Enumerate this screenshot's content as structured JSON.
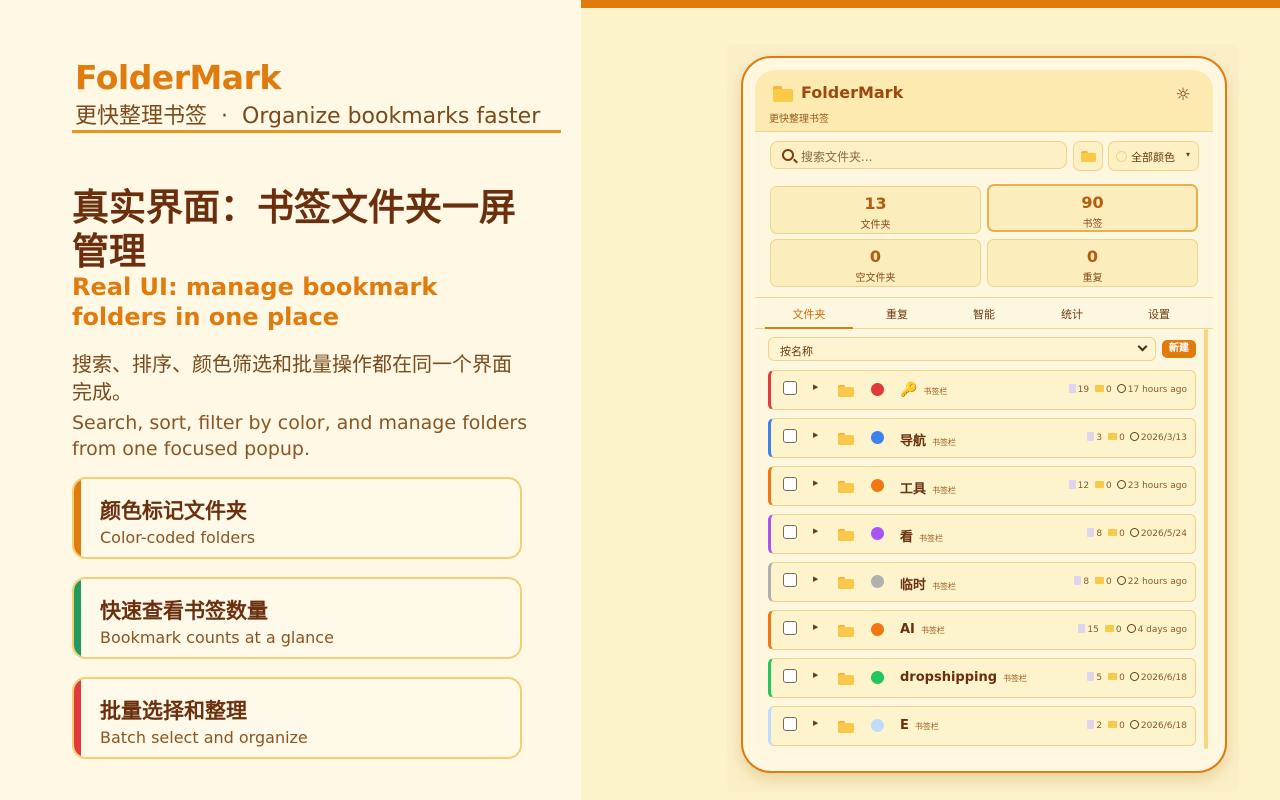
{
  "promo": {
    "brand": "FolderMark",
    "tagline_cn": "更快整理书签",
    "tagline_sep": "·",
    "tagline_en": "Organize bookmarks faster",
    "headline_cn": "真实界面：书签文件夹一屏管理",
    "headline_en": "Real UI: manage bookmark folders in one place",
    "desc_cn": "搜索、排序、颜色筛选和批量操作都在同一个界面完成。",
    "desc_en": "Search, sort, filter by color, and manage folders from one focused popup.",
    "features": [
      {
        "title": "颜色标记文件夹",
        "subtitle": "Color-coded folders",
        "accent": "#e07b0d"
      },
      {
        "title": "快速查看书签数量",
        "subtitle": "Bookmark counts at a glance",
        "accent": "#229a5e"
      },
      {
        "title": "批量选择和整理",
        "subtitle": "Batch select and organize",
        "accent": "#e03a3a"
      }
    ]
  },
  "app": {
    "title": "FolderMark",
    "subtitle": "更快整理书签",
    "search_placeholder": "搜索文件夹...",
    "color_filter": "全部颜色",
    "stats": [
      {
        "value": "13",
        "label": "文件夹"
      },
      {
        "value": "90",
        "label": "书签"
      },
      {
        "value": "0",
        "label": "空文件夹"
      },
      {
        "value": "0",
        "label": "重复"
      }
    ],
    "tabs": [
      "文件夹",
      "重复",
      "智能",
      "统计",
      "设置"
    ],
    "active_tab": "文件夹",
    "sort_label": "按名称",
    "new_button": "新建",
    "folders": [
      {
        "name": "",
        "icon": "key-icon",
        "badge": "书签栏",
        "bookmarks": "19",
        "subfolders": "0",
        "updated": "17 hours ago",
        "color": "#e03a3a"
      },
      {
        "name": "导航",
        "badge": "书签栏",
        "bookmarks": "3",
        "subfolders": "0",
        "updated": "2026/3/13",
        "color": "#3b82f0"
      },
      {
        "name": "工具",
        "badge": "书签栏",
        "bookmarks": "12",
        "subfolders": "0",
        "updated": "23 hours ago",
        "color": "#f07814"
      },
      {
        "name": "看",
        "badge": "书签栏",
        "bookmarks": "8",
        "subfolders": "0",
        "updated": "2026/5/24",
        "color": "#a855f7"
      },
      {
        "name": "临时",
        "badge": "书签栏",
        "bookmarks": "8",
        "subfolders": "0",
        "updated": "22 hours ago",
        "color": "#b0b0b0"
      },
      {
        "name": "AI",
        "badge": "书签栏",
        "bookmarks": "15",
        "subfolders": "0",
        "updated": "4 days ago",
        "color": "#f07814"
      },
      {
        "name": "dropshipping",
        "badge": "书签栏",
        "bookmarks": "5",
        "subfolders": "0",
        "updated": "2026/6/18",
        "color": "#22c55e"
      },
      {
        "name": "E",
        "badge": "书签栏",
        "bookmarks": "2",
        "subfolders": "0",
        "updated": "2026/6/18",
        "color": "#bfdbfe"
      }
    ]
  }
}
